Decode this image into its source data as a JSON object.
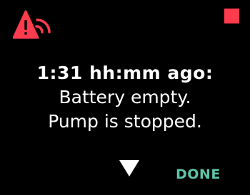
{
  "alert": {
    "icon": "alarm-alert-icon",
    "color": "#ff3b4e",
    "status_color": "#ff3b4e"
  },
  "message": {
    "time_ago": "1:31 hh:mm ago:",
    "line1": "Battery empty.",
    "line2": "Pump is stopped."
  },
  "controls": {
    "down_icon": "down-arrow-icon",
    "done_label": "DONE",
    "done_color": "#5fc4a7"
  }
}
